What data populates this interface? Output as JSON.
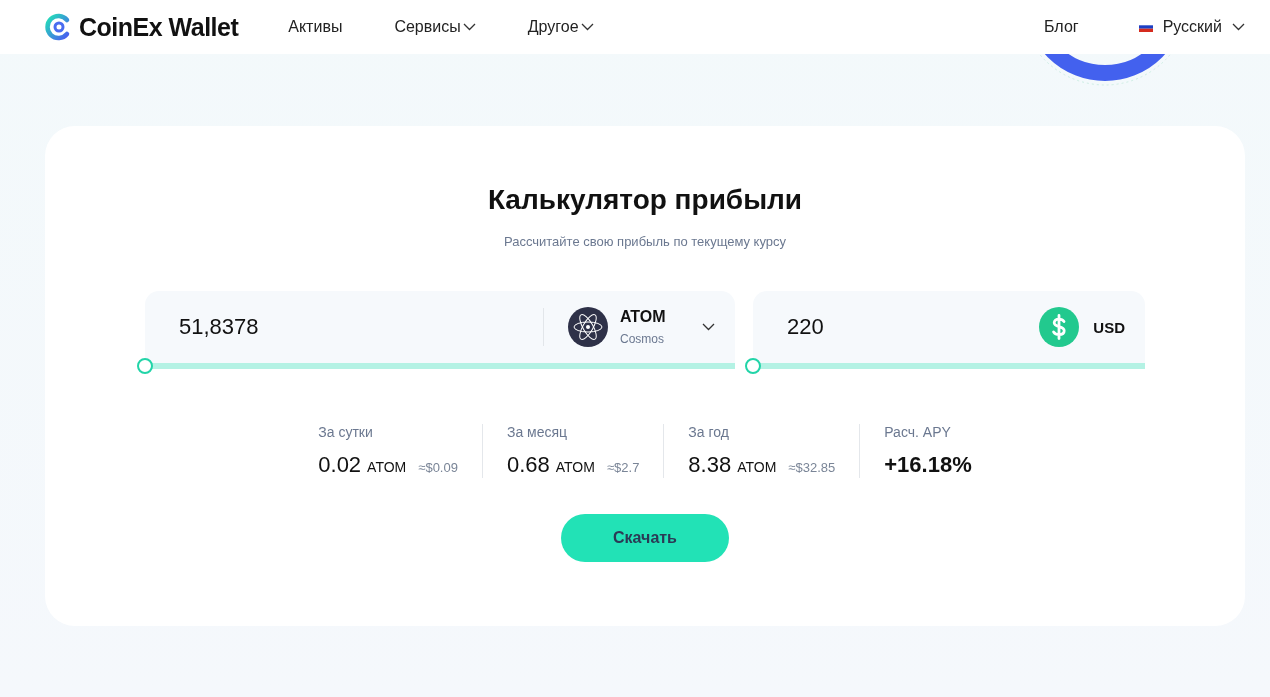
{
  "nav": {
    "logo": "CoinEx Wallet",
    "items": [
      {
        "label": "Активы",
        "dropdown": false
      },
      {
        "label": "Сервисы",
        "dropdown": true
      },
      {
        "label": "Другое",
        "dropdown": true
      }
    ],
    "blog": "Блог",
    "language": "Русский"
  },
  "calculator": {
    "title": "Калькулятор прибыли",
    "subtitle": "Рассчитайте свою прибыль по текущему курсу",
    "coin_input": {
      "value": "51,8378",
      "symbol": "ATOM",
      "name": "Cosmos",
      "level": 0
    },
    "fiat_input": {
      "value": "220",
      "symbol": "USD",
      "level": 0
    },
    "stats": [
      {
        "kind": "earning",
        "label": "За сутки",
        "amount": "0.02",
        "unit": "ATOM",
        "fiat": "≈$0.09"
      },
      {
        "kind": "earning",
        "label": "За месяц",
        "amount": "0.68",
        "unit": "ATOM",
        "fiat": "≈$2.7"
      },
      {
        "kind": "earning",
        "label": "За год",
        "amount": "8.38",
        "unit": "ATOM",
        "fiat": "≈$32.85"
      },
      {
        "kind": "apy",
        "label": "Расч. APY",
        "amount": "+16.18%"
      }
    ],
    "button": "Скачать"
  }
}
